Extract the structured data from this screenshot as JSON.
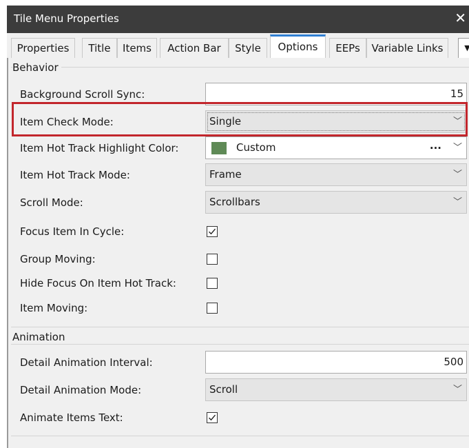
{
  "window": {
    "title": "Tile Menu Properties",
    "close_glyph": "✕"
  },
  "tabs": [
    {
      "label": "Properties",
      "active": false
    },
    {
      "label": "Title",
      "active": false
    },
    {
      "label": "Items",
      "active": false
    },
    {
      "label": "Action Bar",
      "active": false
    },
    {
      "label": "Style",
      "active": false
    },
    {
      "label": "Options",
      "active": true
    },
    {
      "label": "EEPs",
      "active": false
    },
    {
      "label": "Variable Links",
      "active": false
    }
  ],
  "tab_scroll_glyph": "▼",
  "behavior": {
    "heading": "Behavior",
    "background_scroll_sync": {
      "label": "Background Scroll Sync:",
      "value": "15"
    },
    "item_check_mode": {
      "label": "Item Check Mode:",
      "value": "Single"
    },
    "item_hot_track_highlight_color": {
      "label": "Item Hot Track Highlight Color:",
      "value": "Custom",
      "swatch_color": "#5f8a56",
      "ellipsis": "..."
    },
    "item_hot_track_mode": {
      "label": "Item Hot Track Mode:",
      "value": "Frame"
    },
    "scroll_mode": {
      "label": "Scroll Mode:",
      "value": "Scrollbars"
    },
    "focus_item_in_cycle": {
      "label": "Focus Item In Cycle:",
      "checked": true
    },
    "group_moving": {
      "label": "Group Moving:",
      "checked": false
    },
    "hide_focus_on_item_hot_track": {
      "label": "Hide Focus On Item Hot Track:",
      "checked": false
    },
    "item_moving": {
      "label": "Item Moving:",
      "checked": false
    }
  },
  "animation": {
    "heading": "Animation",
    "detail_animation_interval": {
      "label": "Detail Animation Interval:",
      "value": "500"
    },
    "detail_animation_mode": {
      "label": "Detail Animation Mode:",
      "value": "Scroll"
    },
    "animate_items_text": {
      "label": "Animate Items Text:",
      "checked": true
    }
  },
  "colors": {
    "highlight_border": "#c2262c",
    "active_tab_accent": "#2f7fd3",
    "titlebar_bg": "#3c3c3c"
  },
  "icons": {
    "dropdown": "chevron-down-icon",
    "checkmark": "checkmark-icon",
    "close": "close-icon"
  },
  "chevron_glyph": "﹀"
}
